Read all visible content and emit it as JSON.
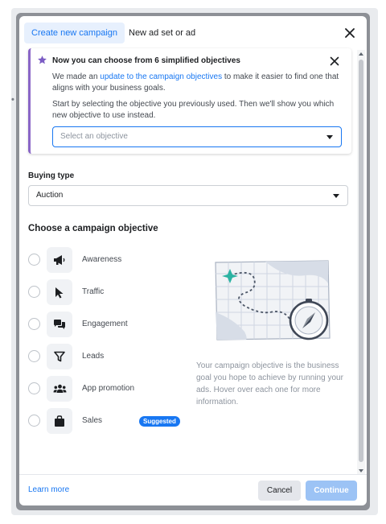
{
  "tabs": [
    {
      "label": "Create new campaign",
      "active": true
    },
    {
      "label": "New ad set or ad",
      "active": false
    }
  ],
  "notice": {
    "title": "Now you can choose from 6 simplified objectives",
    "p1_before": "We made an ",
    "p1_link": "update to the campaign objectives",
    "p1_after": " to make it easier to find one that aligns with your business goals.",
    "p2": "Start by selecting the objective you previously used. Then we'll show you which new objective to use instead.",
    "select_placeholder": "Select an objective",
    "accent_color": "#8a66c7"
  },
  "buying_type": {
    "label": "Buying type",
    "value": "Auction"
  },
  "objectives": {
    "heading": "Choose a campaign objective",
    "items": [
      {
        "label": "Awareness",
        "icon": "megaphone-icon"
      },
      {
        "label": "Traffic",
        "icon": "cursor-icon"
      },
      {
        "label": "Engagement",
        "icon": "chat-bubbles-icon"
      },
      {
        "label": "Leads",
        "icon": "funnel-icon"
      },
      {
        "label": "App promotion",
        "icon": "people-icon"
      },
      {
        "label": "Sales",
        "icon": "shopping-bag-icon",
        "badge": "Suggested"
      }
    ],
    "description": "Your campaign objective is the business goal you hope to achieve by running your ads. Hover over each one for more information."
  },
  "footer": {
    "learn_more": "Learn more",
    "cancel": "Cancel",
    "continue": "Continue"
  },
  "colors": {
    "primary": "#1877f2",
    "disabled_primary": "#9cc3f5",
    "teal_marker": "#2bb3a2"
  }
}
